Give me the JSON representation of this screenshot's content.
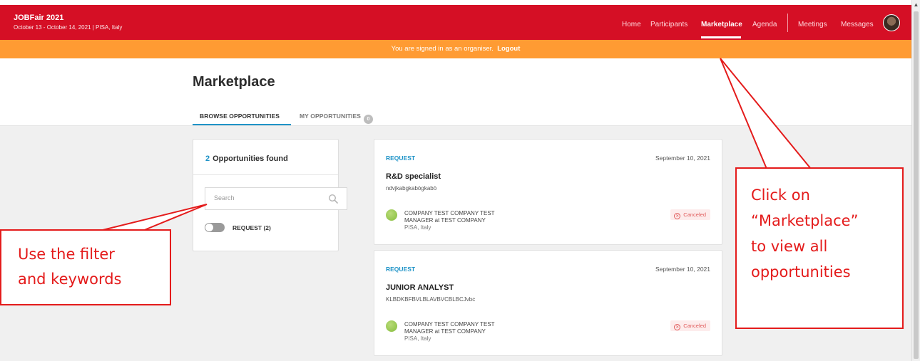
{
  "event": {
    "name": "JOBFair 2021",
    "subtitle": "October 13 - October 14, 2021 | PISA, Italy"
  },
  "nav": {
    "home": "Home",
    "participants": "Participants",
    "marketplace": "Marketplace",
    "agenda": "Agenda",
    "meetings": "Meetings",
    "messages": "Messages"
  },
  "banner": {
    "text": "You are signed in as an organiser.",
    "logout": "Logout"
  },
  "page": {
    "title": "Marketplace"
  },
  "tabs": {
    "browse": "BROWSE OPPORTUNITIES",
    "mine": "MY OPPORTUNITIES",
    "mine_count": "0"
  },
  "filters": {
    "count": "2",
    "found_label": "Opportunities found",
    "search_placeholder": "Search",
    "toggle_label": "REQUEST (2)"
  },
  "opportunities": [
    {
      "type": "REQUEST",
      "date": "September 10, 2021",
      "title": "R&D specialist",
      "description": "ndvjkabgkabògkabò",
      "company_line1": "COMPANY TEST COMPANY TEST",
      "company_line2": "MANAGER at TEST COMPANY",
      "location": "PISA, Italy",
      "status": "Canceled"
    },
    {
      "type": "REQUEST",
      "date": "September 10, 2021",
      "title": "JUNIOR ANALYST",
      "description": "KLBDKBFBVLBLAVBVCBLBCJvbc",
      "company_line1": "COMPANY TEST COMPANY TEST",
      "company_line2": "MANAGER at TEST COMPANY",
      "location": "PISA, Italy",
      "status": "Canceled"
    }
  ],
  "annotations": {
    "left": [
      "Use the filter",
      "and keywords"
    ],
    "right": [
      "Click on",
      "“Marketplace”",
      "to view all",
      "opportunities"
    ]
  },
  "colors": {
    "topbar": "#d50f25",
    "banner": "#ff9b33",
    "accent": "#1f93c7",
    "annotation": "#e41b1b"
  }
}
